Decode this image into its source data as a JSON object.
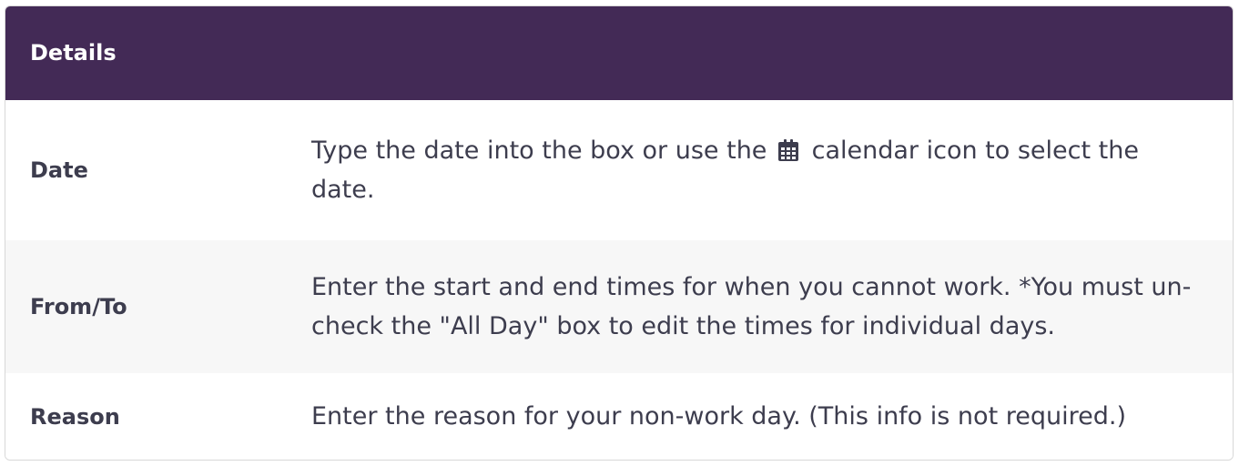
{
  "table": {
    "header": "Details",
    "rows": [
      {
        "label": "Date",
        "desc_before": "Type the date into the box or use the",
        "icon": "calendar-icon",
        "desc_after": "calendar icon to select the date."
      },
      {
        "label": "From/To",
        "desc": "Enter the start and end times for when you cannot work. *You must un-check the \"All Day\" box to edit the times for individual days."
      },
      {
        "label": "Reason",
        "desc": "Enter the reason for your non-work day. (This info is not required.)"
      }
    ]
  },
  "colors": {
    "header_bg": "#432a56",
    "header_text": "#ffffff",
    "body_text": "#3d3d4e",
    "alt_row_bg": "#f7f7f7"
  }
}
